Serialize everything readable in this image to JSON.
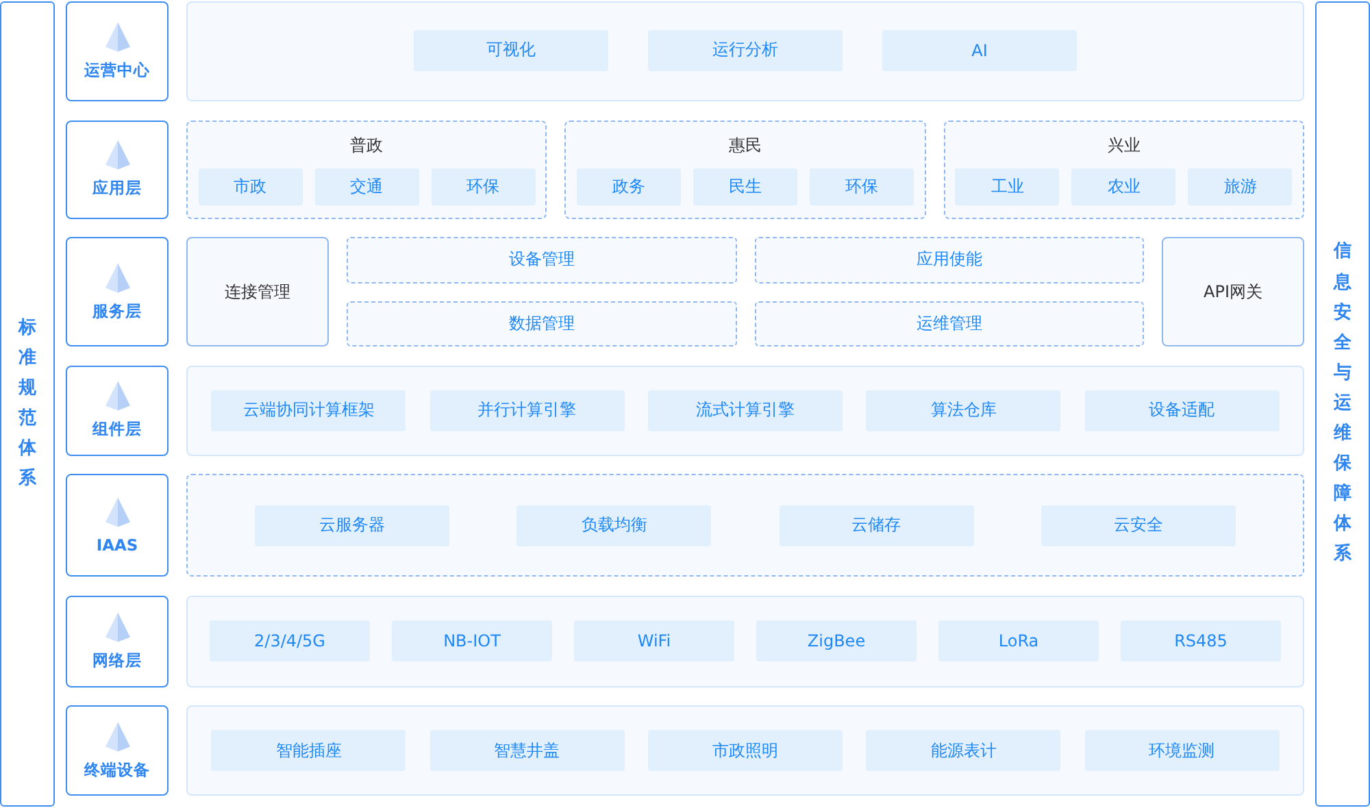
{
  "left_sidebar": {
    "label": "标准规范体系"
  },
  "right_sidebar": {
    "label": "信息安全与运维保障体系"
  },
  "layers": [
    {
      "label": "运营中心",
      "kind": "centered",
      "dashed": false,
      "items": [
        "可视化",
        "运行分析",
        "AI"
      ]
    },
    {
      "label": "应用层",
      "kind": "groups",
      "dashed": true,
      "groups": [
        {
          "title": "普政",
          "items": [
            "市政",
            "交通",
            "环保"
          ]
        },
        {
          "title": "惠民",
          "items": [
            "政务",
            "民生",
            "环保"
          ]
        },
        {
          "title": "兴业",
          "items": [
            "工业",
            "农业",
            "旅游"
          ]
        }
      ]
    },
    {
      "label": "服务层",
      "kind": "service",
      "dashed": true,
      "left": "连接管理",
      "cells": [
        "设备管理",
        "应用使能",
        "数据管理",
        "运维管理"
      ],
      "right": "API网关"
    },
    {
      "label": "组件层",
      "kind": "spread",
      "dashed": false,
      "items": [
        "云端协同计算框架",
        "并行计算引擎",
        "流式计算引擎",
        "算法仓库",
        "设备适配"
      ]
    },
    {
      "label": "IAAS",
      "kind": "spread",
      "dashed": true,
      "items": [
        "云服务器",
        "负载均衡",
        "云储存",
        "云安全"
      ]
    },
    {
      "label": "网络层",
      "kind": "spread",
      "dashed": false,
      "items": [
        "2/3/4/5G",
        "NB-IOT",
        "WiFi",
        "ZigBee",
        "LoRa",
        "RS485"
      ]
    },
    {
      "label": "终端设备",
      "kind": "spread",
      "dashed": false,
      "items": [
        "智能插座",
        "智慧井盖",
        "市政照明",
        "能源表计",
        "环境监测"
      ]
    }
  ]
}
